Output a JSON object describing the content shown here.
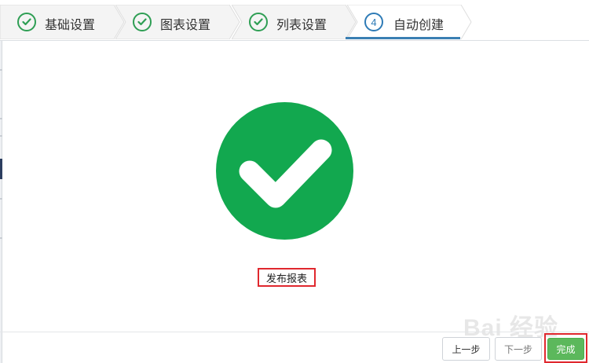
{
  "stepper": {
    "steps": [
      {
        "label": "基础设置",
        "state": "done"
      },
      {
        "label": "图表设置",
        "state": "done"
      },
      {
        "label": "列表设置",
        "state": "done"
      },
      {
        "label": "自动创建",
        "state": "active",
        "number": "4"
      }
    ]
  },
  "content": {
    "success_icon": "check-circle-icon",
    "publish_label": "发布报表"
  },
  "footer": {
    "prev_label": "上一步",
    "next_label": "下一步",
    "finish_label": "完成"
  },
  "watermark": {
    "text": "Bai 经验"
  },
  "colors": {
    "success_green": "#12a84f",
    "step_done": "#2e9e54",
    "step_active": "#2e7bb6",
    "highlight_red": "#e0282e",
    "finish_button": "#5cb85c"
  }
}
